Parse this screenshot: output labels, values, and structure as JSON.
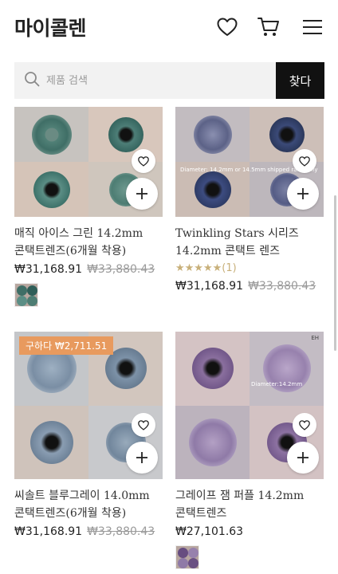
{
  "brand": "마이콜렌",
  "header": {
    "wishlist_icon": "heart-outline-icon",
    "cart_icon": "cart-icon",
    "menu_icon": "hamburger-menu-icon"
  },
  "search": {
    "placeholder": "제품 검색",
    "value": "",
    "button_label": "찾다",
    "icon": "search-icon"
  },
  "colors": {
    "accent_badge": "#e89a5e",
    "search_button": "#111111",
    "rating_star": "#c8b07a",
    "strike_price": "#9a9a9a"
  },
  "products": [
    {
      "name_lines": [
        "매직 아이스 그린 14.2mm",
        "콘택트렌즈(6개월 착용)"
      ],
      "price": "₩31,168.91",
      "original_price": "₩33,880.43",
      "badge": null,
      "rating": null,
      "image_text": [],
      "has_swatch": true
    },
    {
      "name_lines": [
        "Twinkling Stars 시리즈",
        "14.2mm 콘택트 렌즈"
      ],
      "price": "₩31,168.91",
      "original_price": "₩33,880.43",
      "badge": null,
      "rating": {
        "stars": "★★★★★",
        "value": 5,
        "count_label": "(1)"
      },
      "image_text": [
        "Diameter: 14.2mm or 14.5mm shipped randomly"
      ],
      "has_swatch": false
    },
    {
      "name_lines": [
        "씨솔트 블루그레이 14.0mm",
        "콘택트렌즈(6개월 착용)"
      ],
      "price": "₩31,168.91",
      "original_price": "₩33,880.43",
      "badge": "구하다 ₩2,711.51",
      "rating": null,
      "image_text": [],
      "has_swatch": false
    },
    {
      "name_lines": [
        "그레이프 잼 퍼플 14.2mm",
        "콘택트렌즈"
      ],
      "price": "₩27,101.63",
      "original_price": null,
      "badge": null,
      "rating": null,
      "image_text": [
        "Diameter:14.2mm",
        "EH"
      ],
      "has_swatch": true
    }
  ]
}
